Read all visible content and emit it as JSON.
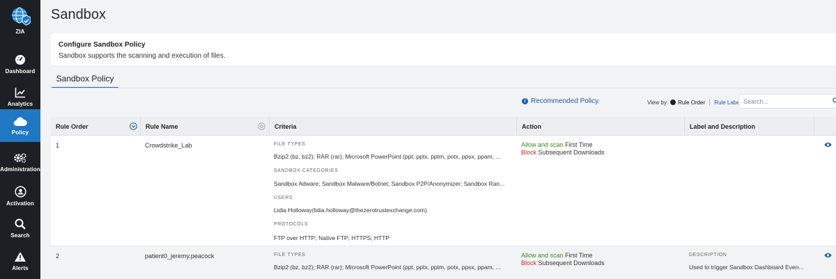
{
  "sidebar": {
    "logo_label": "ZIA",
    "items": [
      {
        "label": "Dashboard",
        "icon": "dashboard-icon"
      },
      {
        "label": "Analytics",
        "icon": "analytics-icon"
      },
      {
        "label": "Policy",
        "icon": "cloud-policy-icon",
        "active": true
      },
      {
        "label": "Administration",
        "icon": "gears-icon"
      },
      {
        "label": "Activation",
        "icon": "activation-user-icon"
      },
      {
        "label": "Search",
        "icon": "search-icon"
      },
      {
        "label": "Alerts",
        "icon": "alert-triangle-icon"
      }
    ]
  },
  "page": {
    "title": "Sandbox",
    "info_heading": "Configure Sandbox Policy",
    "info_text": "Sandbox supports the scanning and execution of files.",
    "tab": "Sandbox Policy"
  },
  "toolbar": {
    "recommended_policy": "Recommended Policy",
    "view_by_label": "View by:",
    "view_by_selected": "Rule Order",
    "view_by_other": "Rule Label",
    "search_placeholder": "Search..."
  },
  "table": {
    "headers": [
      "Rule Order",
      "Rule Name",
      "Criteria",
      "Action",
      "Label and Description",
      ""
    ],
    "rows": [
      {
        "order": "1",
        "name": "Crowdstrike_Lab",
        "criteria": [
          {
            "heading": "FILE TYPES",
            "value": "Bzip2 (bz, bz2); RAR (rar); Microsoft PowerPoint (ppt, pptx, pptm, potx, ppsx, ppam, ..."
          },
          {
            "heading": "SANDBOX CATEGORIES",
            "value": "Sandbox Adware; Sandbox Malware/Botnet; Sandbox P2P/Anonymizer; Sandbox Ran..."
          },
          {
            "heading": "USERS",
            "value": "Lidia Holloway(lidia.holloway@thezerotrustexchange.com)"
          },
          {
            "heading": "PROTOCOLS",
            "value": "FTP over HTTP; Native FTP; HTTPS; HTTP"
          }
        ],
        "action_first_hl": "Allow and scan",
        "action_first_rest": "First Time",
        "action_second_hl": "Block",
        "action_second_rest": "Subsequent Downloads",
        "label_heading": "",
        "label_value": ""
      },
      {
        "order": "2",
        "name": "patient0_jeremy.peacock",
        "criteria": [
          {
            "heading": "FILE TYPES",
            "value": "Bzip2 (bz, bz2); RAR (rar); Microsoft PowerPoint (ppt, pptx, pptm, potx, ppsx, ppam, ..."
          }
        ],
        "action_first_hl": "Allow and scan",
        "action_first_rest": "First Time",
        "action_second_hl": "Block",
        "action_second_rest": "Subsequent Downloads",
        "label_heading": "DESCRIPTION",
        "label_value": "Used to trigger Sandbox Dashboard Even..."
      }
    ]
  },
  "colors": {
    "sidebar_bg": "#1c1f24",
    "active_nav": "#2077c4",
    "link": "#1d5fa8",
    "allow_green": "#3c8a1d",
    "block_red": "#c92a2a"
  }
}
